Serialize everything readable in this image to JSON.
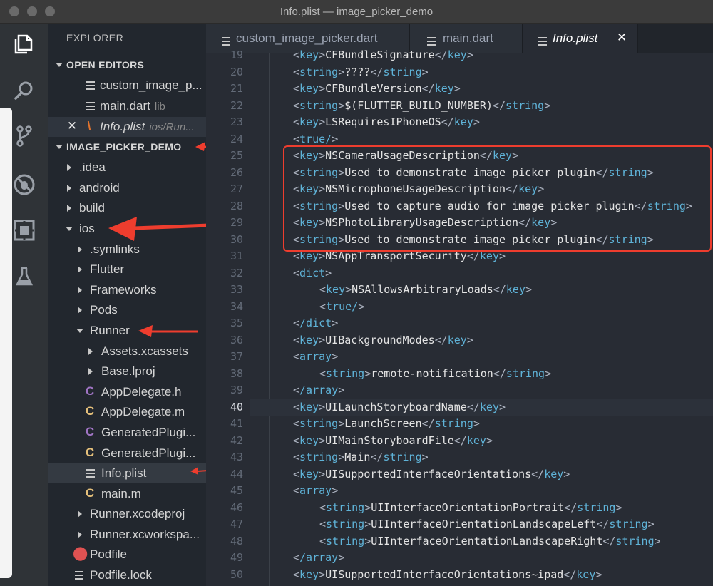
{
  "window": {
    "title": "Info.plist — image_picker_demo"
  },
  "activity_icons": [
    "files-icon",
    "search-icon",
    "source-control-icon",
    "debug-icon",
    "extensions-icon",
    "test-flask-icon"
  ],
  "explorer": {
    "title": "EXPLORER",
    "open_editors": {
      "label": "OPEN EDITORS",
      "items": [
        {
          "name": "custom_image_p...",
          "path": ""
        },
        {
          "name": "main.dart",
          "path": "lib"
        },
        {
          "name": "Info.plist",
          "path": "ios/Run..."
        }
      ]
    },
    "project": {
      "label": "IMAGE_PICKER_DEMO",
      "items": [
        ".idea",
        "android",
        "build",
        "ios",
        ".symlinks",
        "Flutter",
        "Frameworks",
        "Pods",
        "Runner",
        "Assets.xcassets",
        "Base.lproj",
        "AppDelegate.h",
        "AppDelegate.m",
        "GeneratedPlugi...",
        "GeneratedPlugi...",
        "Info.plist",
        "main.m",
        "Runner.xcodeproj",
        "Runner.xcworkspa...",
        "Podfile",
        "Podfile.lock"
      ]
    }
  },
  "tabs": [
    {
      "label": "custom_image_picker.dart"
    },
    {
      "label": "main.dart"
    },
    {
      "label": "Info.plist",
      "close": "✕"
    }
  ],
  "editor": {
    "current_line": 40,
    "line_numbers": [
      "19",
      "20",
      "21",
      "22",
      "23",
      "24",
      "25",
      "26",
      "27",
      "28",
      "29",
      "30",
      "31",
      "32",
      "33",
      "34",
      "35",
      "36",
      "37",
      "38",
      "39",
      "40",
      "41",
      "42",
      "43",
      "44",
      "45",
      "46",
      "47",
      "48",
      "49",
      "50"
    ],
    "lines": [
      {
        "indent": 0,
        "tag": "key",
        "value": "CFBundleSignature"
      },
      {
        "indent": 0,
        "tag": "string",
        "value": "????"
      },
      {
        "indent": 0,
        "tag": "key",
        "value": "CFBundleVersion"
      },
      {
        "indent": 0,
        "tag": "string",
        "value": "$(FLUTTER_BUILD_NUMBER)"
      },
      {
        "indent": 0,
        "tag": "key",
        "value": "LSRequiresIPhoneOS"
      },
      {
        "indent": 0,
        "tag": "true/",
        "value": ""
      },
      {
        "indent": 0,
        "tag": "key",
        "value": "NSCameraUsageDescription"
      },
      {
        "indent": 0,
        "tag": "string",
        "value": "Used to demonstrate image picker plugin"
      },
      {
        "indent": 0,
        "tag": "key",
        "value": "NSMicrophoneUsageDescription"
      },
      {
        "indent": 0,
        "tag": "string",
        "value": "Used to capture audio for image picker plugin"
      },
      {
        "indent": 0,
        "tag": "key",
        "value": "NSPhotoLibraryUsageDescription"
      },
      {
        "indent": 0,
        "tag": "string",
        "value": "Used to demonstrate image picker plugin"
      },
      {
        "indent": 0,
        "tag": "key",
        "value": "NSAppTransportSecurity"
      },
      {
        "indent": 0,
        "tag": "dict",
        "value": ""
      },
      {
        "indent": 1,
        "tag": "key",
        "value": "NSAllowsArbitraryLoads"
      },
      {
        "indent": 1,
        "tag": "true/",
        "value": ""
      },
      {
        "indent": 0,
        "tag": "/dict",
        "value": ""
      },
      {
        "indent": 0,
        "tag": "key",
        "value": "UIBackgroundModes"
      },
      {
        "indent": 0,
        "tag": "array",
        "value": ""
      },
      {
        "indent": 1,
        "tag": "string",
        "value": "remote-notification"
      },
      {
        "indent": 0,
        "tag": "/array",
        "value": ""
      },
      {
        "indent": 0,
        "tag": "key",
        "value": "UILaunchStoryboardName"
      },
      {
        "indent": 0,
        "tag": "string",
        "value": "LaunchScreen"
      },
      {
        "indent": 0,
        "tag": "key",
        "value": "UIMainStoryboardFile"
      },
      {
        "indent": 0,
        "tag": "string",
        "value": "Main"
      },
      {
        "indent": 0,
        "tag": "key",
        "value": "UISupportedInterfaceOrientations"
      },
      {
        "indent": 0,
        "tag": "array",
        "value": ""
      },
      {
        "indent": 1,
        "tag": "string",
        "value": "UIInterfaceOrientationPortrait"
      },
      {
        "indent": 1,
        "tag": "string",
        "value": "UIInterfaceOrientationLandscapeLeft"
      },
      {
        "indent": 1,
        "tag": "string",
        "value": "UIInterfaceOrientationLandscapeRight"
      },
      {
        "indent": 0,
        "tag": "/array",
        "value": ""
      },
      {
        "indent": 0,
        "tag": "key",
        "value": "UISupportedInterfaceOrientations~ipad"
      }
    ]
  },
  "colors": {
    "tag": "#5fb3d8",
    "punctuation": "#abb2bf",
    "value": "#e4e4e4",
    "annotation": "#ee3d2e",
    "objc_h": "#a074c4",
    "objc_m": "#e5c07b",
    "podfile": "#e05252"
  }
}
